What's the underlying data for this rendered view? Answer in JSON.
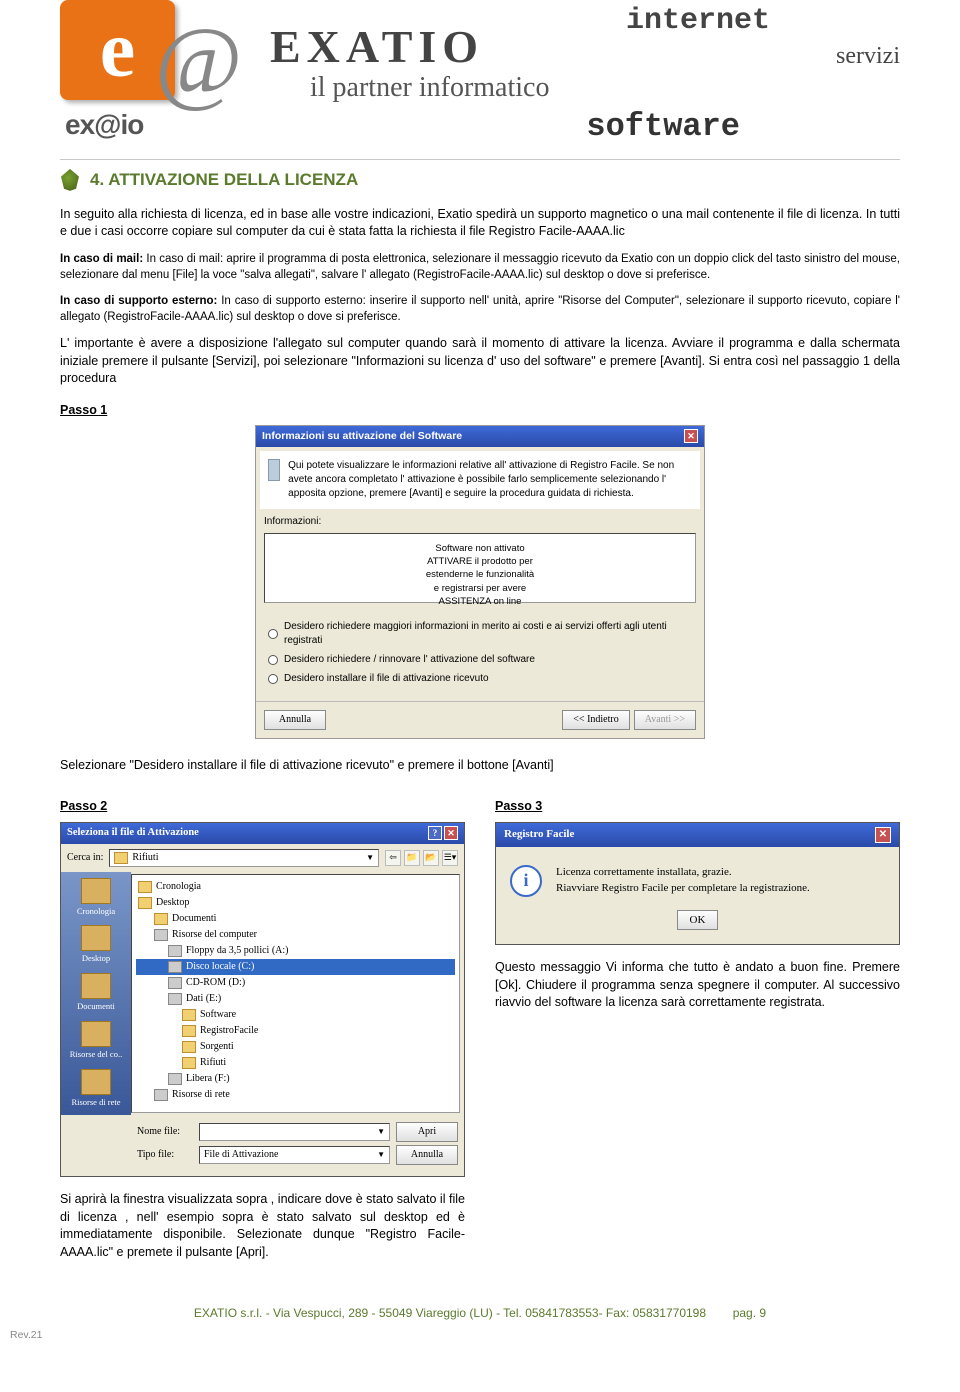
{
  "header": {
    "brand_big": "EXATIO",
    "brand_e": "e",
    "brand_at": "@",
    "partner": "il partner informatico",
    "brand_small": "ex@io",
    "word_internet": "internet",
    "word_servizi": "servizi",
    "word_software": "software"
  },
  "section": {
    "title": "4. ATTIVAZIONE DELLA LICENZA"
  },
  "body": {
    "p1": "In seguito alla richiesta di licenza, ed in base alle vostre indicazioni, Exatio spedirà un supporto magnetico o una mail contenente il file di licenza. In tutti e due i casi occorre copiare sul computer da cui è stata fatta la richiesta il file Registro Facile-AAAA.lic",
    "p2": "In caso di mail: aprire il programma di posta elettronica, selezionare il messaggio ricevuto da Exatio con un doppio click del tasto sinistro del mouse, selezionare dal menu [File] la voce \"salva allegati\", salvare l' allegato (RegistroFacile-AAAA.lic) sul desktop o dove si preferisce.",
    "p3": "In caso di supporto esterno: inserire il supporto nell' unità, aprire \"Risorse del Computer\", selezionare il supporto ricevuto, copiare l' allegato (RegistroFacile-AAAA.lic) sul desktop o dove si preferisce.",
    "p4": "L' importante è avere a disposizione l'allegato sul computer quando sarà il momento di attivare la licenza. Avviare il programma e dalla schermata iniziale premere il pulsante [Servizi], poi selezionare \"Informazioni su licenza d' uso del software\" e premere [Avanti]. Si entra così nel passaggio 1 della procedura",
    "passo1": "Passo 1",
    "mid": "Selezionare \"Desidero installare il file di attivazione ricevuto\" e premere il bottone [Avanti]",
    "passo2": "Passo 2",
    "passo3": "Passo 3",
    "p_left": "Si aprirà la finestra visualizzata sopra , indicare dove è stato salvato il file di licenza , nell' esempio sopra è stato salvato sul desktop ed è immediatamente disponibile. Selezionate dunque \"Registro Facile-AAAA.lic\" e premete il pulsante [Apri].",
    "p_right": "Questo messaggio Vi informa che tutto è andato a buon fine. Premere [Ok]. Chiudere il programma senza spegnere il computer. Al successivo riavvio del software la licenza sarà correttamente registrata."
  },
  "dlg1": {
    "title": "Informazioni su attivazione del Software",
    "intro": "Qui potete visualizzare le informazioni relative all' attivazione di Registro Facile. Se non avete ancora completato l' attivazione è possibile farlo semplicemente selezionando l' apposita opzione, premere [Avanti] e seguire la procedura guidata di richiesta.",
    "label_info": "Informazioni:",
    "info_lines": "Software non attivato\nATTIVARE il prodotto per\nestenderne le funzionalità\ne registrarsi per avere\nASSITENZA on line",
    "opt1": "Desidero richiedere maggiori informazioni in merito ai costi e ai servizi offerti agli utenti registrati",
    "opt2": "Desidero richiedere / rinnovare l' attivazione del software",
    "opt3": "Desidero installare il file di attivazione ricevuto",
    "btn_cancel": "Annulla",
    "btn_back": "<< Indietro",
    "btn_next": "Avanti >>"
  },
  "dlg2": {
    "title": "Seleziona il file di Attivazione",
    "lbl_lookin": "Cerca in:",
    "lookin_value": "Rifiuti",
    "sidebar": [
      "Cronologia",
      "Desktop",
      "Documenti",
      "Risorse del co..",
      "Risorse di rete"
    ],
    "files": [
      {
        "name": "Cronologia",
        "indent": 0,
        "icon": "folder"
      },
      {
        "name": "Desktop",
        "indent": 0,
        "icon": "folder"
      },
      {
        "name": "Documenti",
        "indent": 1,
        "icon": "folder"
      },
      {
        "name": "Risorse del computer",
        "indent": 1,
        "icon": "drive"
      },
      {
        "name": "Floppy da 3,5 pollici (A:)",
        "indent": 2,
        "icon": "drive"
      },
      {
        "name": "Disco locale (C:)",
        "indent": 2,
        "icon": "drive",
        "selected": true
      },
      {
        "name": "CD-ROM (D:)",
        "indent": 2,
        "icon": "drive"
      },
      {
        "name": "Dati (E:)",
        "indent": 2,
        "icon": "drive"
      },
      {
        "name": "Software",
        "indent": 3,
        "icon": "folder"
      },
      {
        "name": "RegistroFacile",
        "indent": 3,
        "icon": "folder"
      },
      {
        "name": "Sorgenti",
        "indent": 3,
        "icon": "folder"
      },
      {
        "name": "Rifiuti",
        "indent": 3,
        "icon": "folder"
      },
      {
        "name": "Libera (F:)",
        "indent": 2,
        "icon": "drive"
      },
      {
        "name": "Risorse di rete",
        "indent": 1,
        "icon": "drive"
      }
    ],
    "lbl_filename": "Nome file:",
    "filename_value": "",
    "lbl_filetype": "Tipo file:",
    "filetype_value": "File di Attivazione",
    "btn_open": "Apri",
    "btn_cancel": "Annulla"
  },
  "dlg3": {
    "title": "Registro Facile",
    "line1": "Licenza correttamente installata, grazie.",
    "line2": "Riavviare Registro Facile per completare la registrazione.",
    "btn_ok": "OK"
  },
  "footer": {
    "text": "EXATIO s.r.l. - Via Vespucci, 289 - 55049 Viareggio (LU) - Tel. 05841783553- Fax: 05831770198",
    "page": "pag. 9",
    "rev": "Rev.21"
  }
}
